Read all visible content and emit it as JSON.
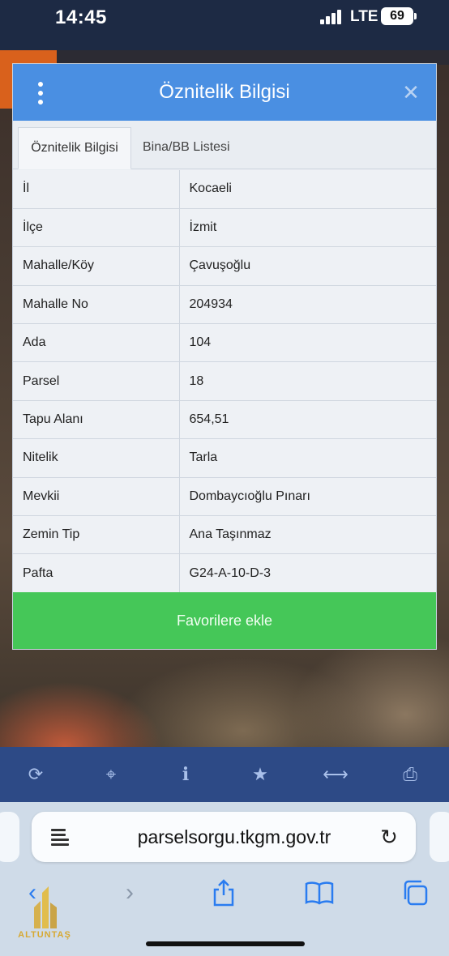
{
  "status": {
    "time": "14:45",
    "network": "LTE",
    "battery": "69"
  },
  "dialog": {
    "title": "Öznitelik Bilgisi",
    "tabs": [
      {
        "label": "Öznitelik Bilgisi",
        "active": true
      },
      {
        "label": "Bina/BB Listesi",
        "active": false
      }
    ],
    "rows": [
      {
        "key": "İl",
        "value": "Kocaeli"
      },
      {
        "key": "İlçe",
        "value": "İzmit"
      },
      {
        "key": "Mahalle/Köy",
        "value": "Çavuşoğlu"
      },
      {
        "key": "Mahalle No",
        "value": "204934"
      },
      {
        "key": "Ada",
        "value": "104"
      },
      {
        "key": "Parsel",
        "value": "18"
      },
      {
        "key": "Tapu Alanı",
        "value": "654,51"
      },
      {
        "key": "Nitelik",
        "value": "Tarla"
      },
      {
        "key": "Mevkii",
        "value": "Dombaycıoğlu Pınarı"
      },
      {
        "key": "Zemin Tip",
        "value": "Ana Taşınmaz"
      },
      {
        "key": "Pafta",
        "value": "G24-A-10-D-3"
      }
    ],
    "favorite_button": "Favorilere ekle"
  },
  "toolbar": {
    "icons": [
      "refresh-icon",
      "locate-icon",
      "info-icon",
      "star-icon",
      "measure-icon",
      "print-icon"
    ]
  },
  "browser": {
    "url": "parselsorgu.tkgm.gov.tr"
  },
  "logo": {
    "text": "ALTUNTAŞ"
  },
  "colors": {
    "header": "#4a8fe2",
    "favorite_button": "#45c758",
    "toolbar": "#2d4a86",
    "browser_accent": "#2a7cf0"
  }
}
